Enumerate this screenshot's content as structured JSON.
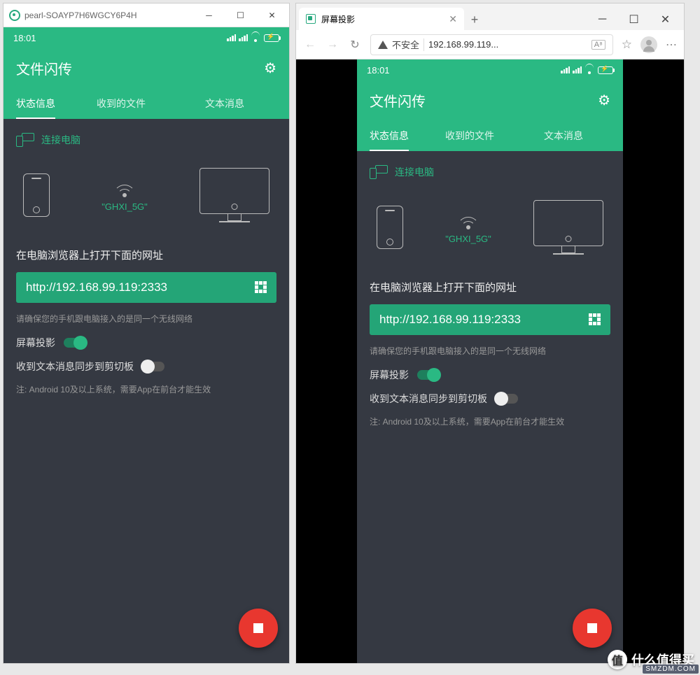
{
  "window1": {
    "title": "pearl-SOAYP7H6WGCY6P4H"
  },
  "browser": {
    "tab_title": "屏幕投影",
    "insecure_label": "不安全",
    "url": "192.168.99.119...",
    "reader_badge": "A⁸"
  },
  "statusbar": {
    "time": "18:01"
  },
  "app": {
    "title": "文件闪传",
    "tabs": {
      "t0": "状态信息",
      "t1": "收到的文件",
      "t2": "文本消息"
    },
    "connect_label": "连接电脑",
    "ssid": "\"GHXI_5G\"",
    "open_hint": "在电脑浏览器上打开下面的网址",
    "url": "http://192.168.99.119:2333",
    "same_network_note": "请确保您的手机跟电脑接入的是同一个无线网络",
    "projection_label": "屏幕投影",
    "clipboard_label": "收到文本消息同步到剪切板",
    "android_note": "注: Android 10及以上系统，需要App在前台才能生效"
  },
  "watermark": {
    "badge": "值",
    "text": "什么值得买",
    "src": "SMZDM.COM"
  }
}
